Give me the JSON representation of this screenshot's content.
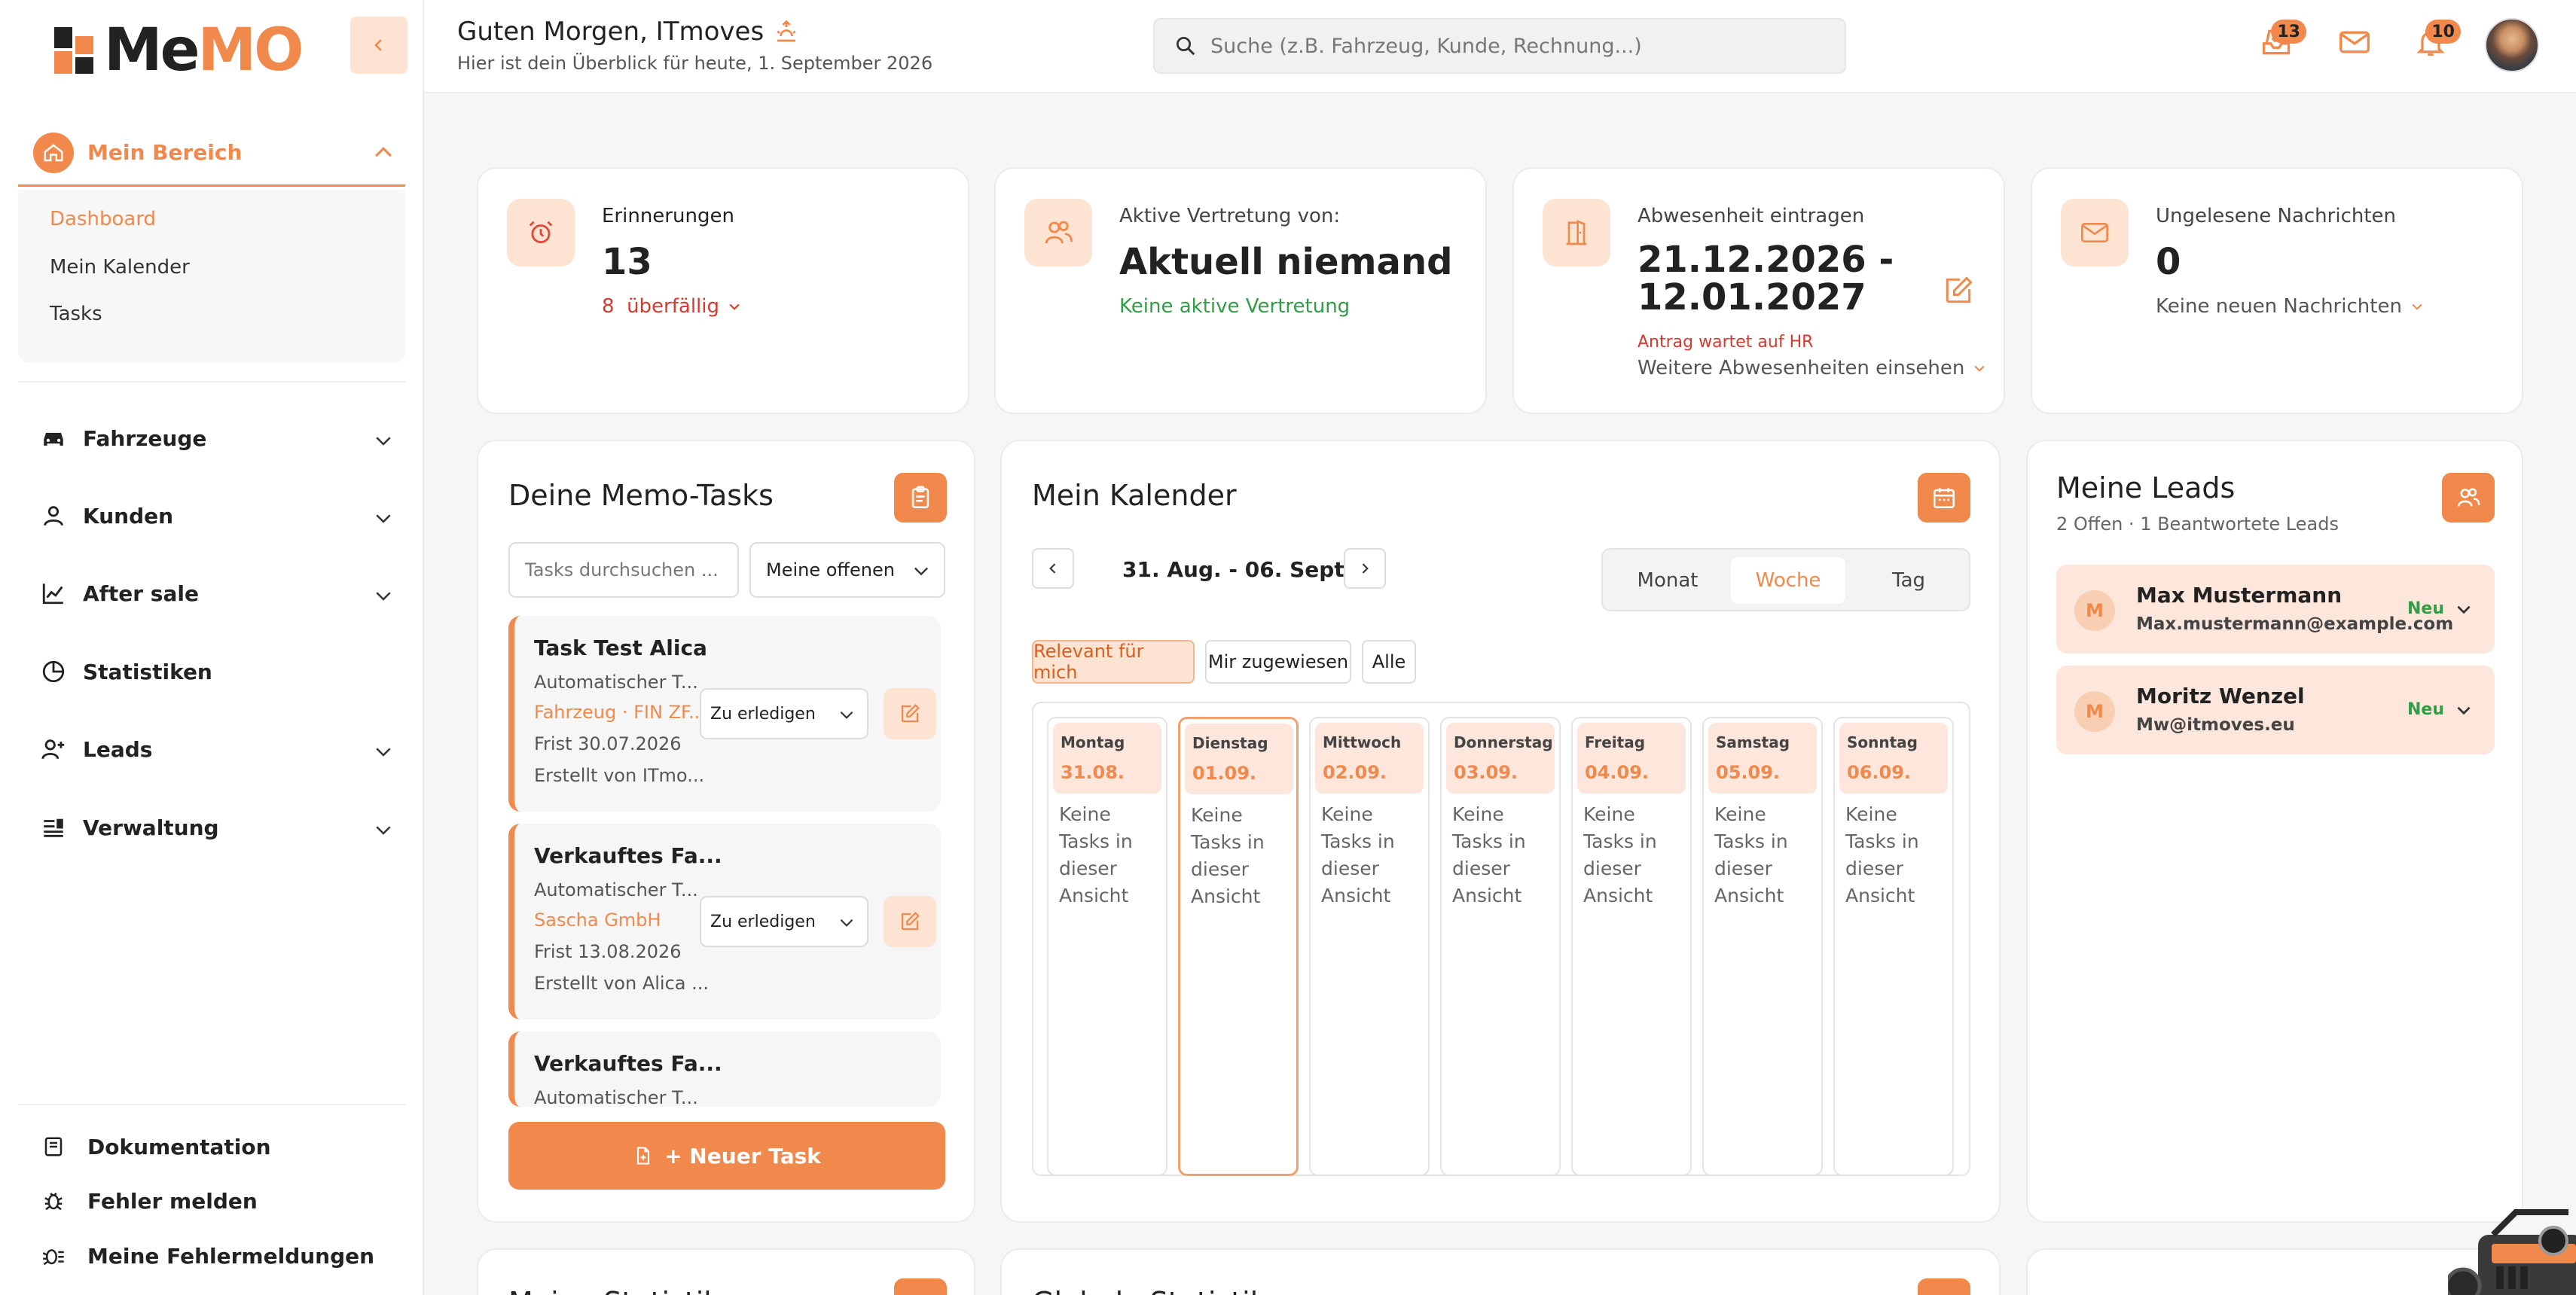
{
  "app": {
    "logo": "MeMO",
    "accent": "#f0894b"
  },
  "sidebar": {
    "section_title": "Mein Bereich",
    "sub_items": [
      "Dashboard",
      "Mein Kalender",
      "Tasks"
    ],
    "nav": [
      {
        "label": "Fahrzeuge",
        "icon": "car-icon"
      },
      {
        "label": "Kunden",
        "icon": "user-icon"
      },
      {
        "label": "After sale",
        "icon": "chart-line-icon"
      },
      {
        "label": "Statistiken",
        "icon": "pie-chart-icon"
      },
      {
        "label": "Leads",
        "icon": "user-plus-icon"
      },
      {
        "label": "Verwaltung",
        "icon": "settings-list-icon"
      }
    ],
    "bottom": [
      {
        "label": "Dokumentation",
        "icon": "book-icon"
      },
      {
        "label": "Fehler melden",
        "icon": "bug-icon"
      },
      {
        "label": "Meine Fehlermeldungen",
        "icon": "bug-list-icon"
      }
    ]
  },
  "header": {
    "greeting": "Guten Morgen, ITmoves",
    "subtitle": "Hier ist dein Überblick für heute, 1. September 2026",
    "search_placeholder": "Suche (z.B. Fahrzeug, Kunde, Rechnung...)",
    "tasks_badge": "13",
    "notifications_badge": "10"
  },
  "summary": {
    "reminders": {
      "label": "Erinnerungen",
      "value": "13",
      "overdue": "8  überfällig"
    },
    "substitute": {
      "label": "Aktive Vertretung von:",
      "value": "Aktuell niemand",
      "status": "Keine aktive Vertretung"
    },
    "absence": {
      "label": "Abwesenheit eintragen",
      "value_line1": "21.12.2026 -",
      "value_line2": "12.01.2027",
      "status": "Antrag wartet auf HR",
      "more": "Weitere Abwesenheiten einsehen"
    },
    "messages": {
      "label": "Ungelesene Nachrichten",
      "value": "0",
      "status": "Keine neuen Nachrichten"
    }
  },
  "tasks": {
    "title": "Deine Memo-Tasks",
    "search_placeholder": "Tasks durchsuchen ...",
    "filter": "Meine offenen T",
    "items": [
      {
        "title": "Task Test Alica",
        "type": "Automatischer T...",
        "link": "Fahrzeug · FIN ZF...",
        "due": "Frist 30.07.2026",
        "creator": "Erstellt von ITmo...",
        "status": "Zu erledigen"
      },
      {
        "title": "Verkauftes Fa...",
        "type": "Automatischer T...",
        "link": "Sascha GmbH",
        "due": "Frist 13.08.2026",
        "creator": "Erstellt von Alica ...",
        "status": "Zu erledigen"
      },
      {
        "title": "Verkauftes Fa...",
        "type": "Automatischer T..."
      }
    ],
    "new_button": "+ Neuer Task"
  },
  "calendar": {
    "title": "Mein Kalender",
    "range": "31. Aug. - 06. Sept.",
    "views": [
      "Monat",
      "Woche",
      "Tag"
    ],
    "active_view": "Woche",
    "filters": [
      "Relevant für mich",
      "Mir zugewiesen",
      "Alle"
    ],
    "days": [
      {
        "name": "Montag",
        "date": "31.08."
      },
      {
        "name": "Dienstag",
        "date": "01.09."
      },
      {
        "name": "Mittwoch",
        "date": "02.09."
      },
      {
        "name": "Donnerstag",
        "date": "03.09."
      },
      {
        "name": "Freitag",
        "date": "04.09."
      },
      {
        "name": "Samstag",
        "date": "05.09."
      },
      {
        "name": "Sonntag",
        "date": "06.09."
      }
    ],
    "empty_text": "Keine Tasks in dieser Ansicht"
  },
  "leads": {
    "title": "Meine Leads",
    "subtitle": "2 Offen · 1 Beantwortete Leads",
    "items": [
      {
        "initial": "M",
        "name": "Max Mustermann",
        "email": "Max.mustermann@example.com",
        "status": "Neu"
      },
      {
        "initial": "M",
        "name": "Moritz Wenzel",
        "email": "Mw@itmoves.eu",
        "status": "Neu"
      }
    ]
  },
  "bottom_panels": {
    "left_title": "Meine Statistik",
    "mid_title": "Globale Statistik"
  }
}
